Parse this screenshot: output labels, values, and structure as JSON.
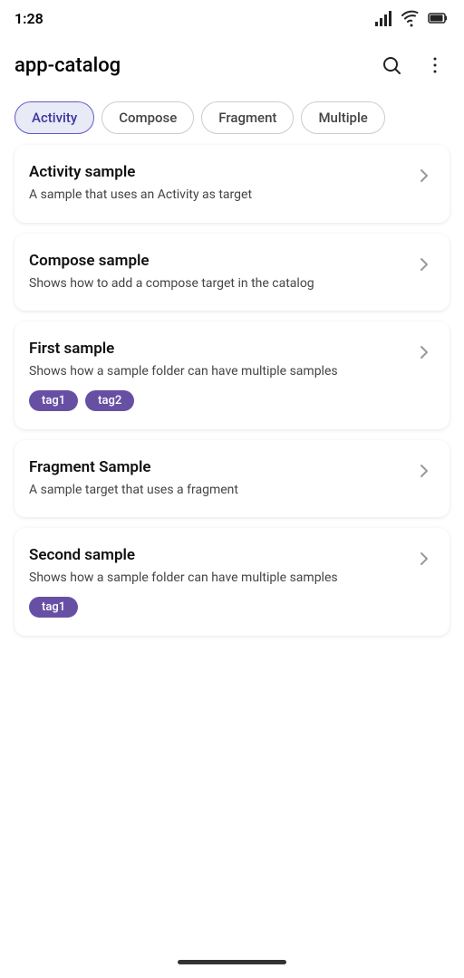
{
  "statusBar": {
    "time": "1:28",
    "icons": [
      "signal",
      "wifi",
      "battery"
    ]
  },
  "toolbar": {
    "title": "app-catalog",
    "searchLabel": "Search",
    "moreLabel": "More options"
  },
  "filters": [
    {
      "id": "activity",
      "label": "Activity",
      "active": true
    },
    {
      "id": "compose",
      "label": "Compose",
      "active": false
    },
    {
      "id": "fragment",
      "label": "Fragment",
      "active": false
    },
    {
      "id": "multiple",
      "label": "Multiple",
      "active": false
    }
  ],
  "items": [
    {
      "title": "Activity sample",
      "desc": "A sample that uses an Activity as target",
      "tags": []
    },
    {
      "title": "Compose sample",
      "desc": "Shows how to add a compose target in the catalog",
      "tags": []
    },
    {
      "title": "First sample",
      "desc": "Shows how a sample folder can have multiple samples",
      "tags": [
        "tag1",
        "tag2"
      ]
    },
    {
      "title": "Fragment Sample",
      "desc": "A sample target that uses a fragment",
      "tags": []
    },
    {
      "title": "Second sample",
      "desc": "Shows how a sample folder can have multiple samples",
      "tags": [
        "tag1"
      ]
    }
  ]
}
